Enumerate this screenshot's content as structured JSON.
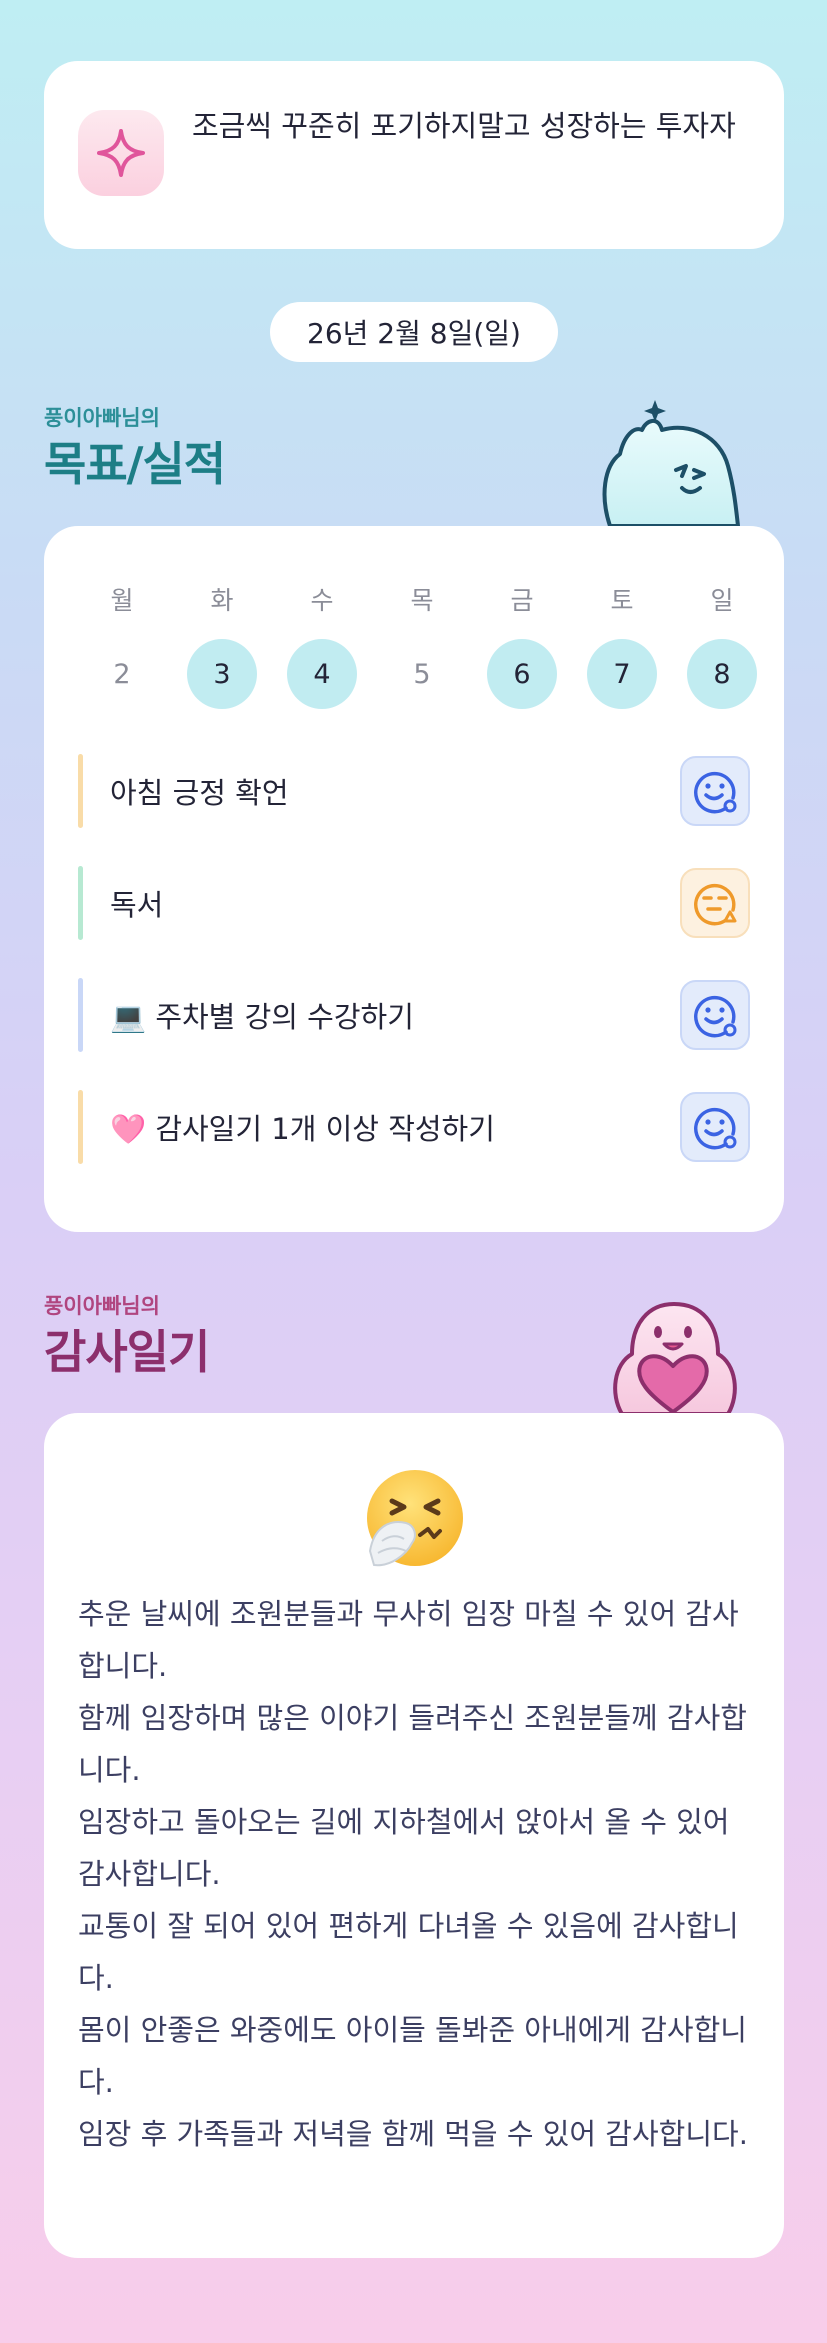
{
  "goal": {
    "text": "조금씩 꾸준히 포기하지말고 성장하는 투자자",
    "icon": "sparkle-icon"
  },
  "date": "26년 2월 8일(일)",
  "goals_section": {
    "subtitle": "풍이아빠님의",
    "title": "목표/실적",
    "week": [
      {
        "day": "월",
        "num": "2",
        "done": false
      },
      {
        "day": "화",
        "num": "3",
        "done": true
      },
      {
        "day": "수",
        "num": "4",
        "done": true
      },
      {
        "day": "목",
        "num": "5",
        "done": false
      },
      {
        "day": "금",
        "num": "6",
        "done": true
      },
      {
        "day": "토",
        "num": "7",
        "done": true
      },
      {
        "day": "일",
        "num": "8",
        "done": true
      }
    ],
    "items": [
      {
        "label": "아침 긍정 확언",
        "bar_color": "#f9dca8",
        "status": "good"
      },
      {
        "label": "독서",
        "bar_color": "#b7e9d2",
        "status": "meh"
      },
      {
        "label": "💻 주차별 강의 수강하기",
        "bar_color": "#c9d7f7",
        "status": "good"
      },
      {
        "label": "🩷 감사일기 1개 이상 작성하기",
        "bar_color": "#f9dca8",
        "status": "good"
      }
    ]
  },
  "diary_section": {
    "subtitle": "풍이아빠님의",
    "title": "감사일기",
    "emoji": "sneezing-face-icon",
    "text": "추운 날씨에 조원분들과 무사히 임장 마칠 수 있어 감사합니다.\n함께 임장하며 많은 이야기 들려주신 조원분들께 감사합니다.\n임장하고 돌아오는 길에 지하철에서 앉아서 올 수 있어 감사합니다.\n교통이 잘 되어 있어 편하게 다녀올 수 있음에 감사합니다.\n몸이 안좋은 와중에도 아이들 돌봐준 아내에게 감사합니다.\n임장 후 가족들과 저녁을 함께 먹을 수 있어 감사합니다."
  },
  "colors": {
    "teal_title": "#1d7e86",
    "magenta_title": "#8c2f6c",
    "done_circle": "#c1ecf1",
    "status_good": "#3b63e3",
    "status_meh": "#ef9a2b"
  }
}
